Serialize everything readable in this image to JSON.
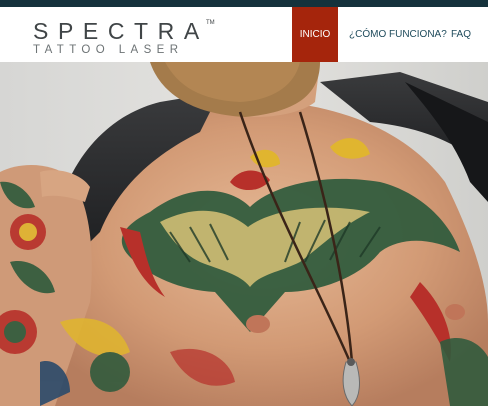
{
  "brand": {
    "name": "SPECTRA",
    "trademark": "TM",
    "tagline": "TATTOO LASER"
  },
  "nav": {
    "items": [
      {
        "label": "INICIO",
        "active": true
      },
      {
        "label": "¿CÓMO FUNCIONA?",
        "active": false
      },
      {
        "label": "FAQ",
        "active": false
      }
    ]
  },
  "colors": {
    "top_strip": "#15323c",
    "active_nav_bg": "#a5250c",
    "nav_text": "#1f4b5c",
    "logo_text": "#404547"
  },
  "hero": {
    "image_subject": "tattooed-man-chest"
  }
}
